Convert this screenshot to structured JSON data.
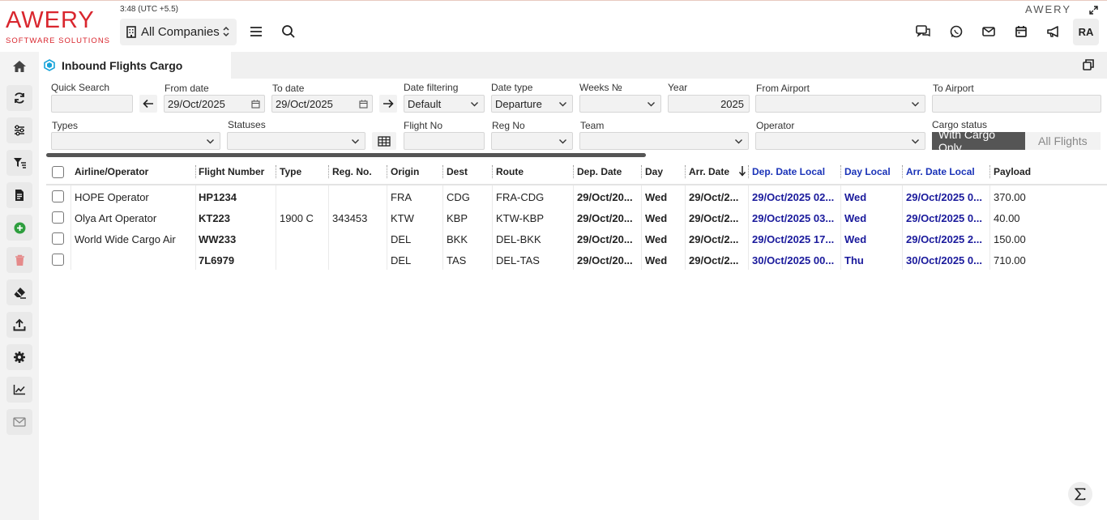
{
  "app": {
    "logo": "AWERY",
    "logo_sub": "SOFTWARE SOLUTIONS",
    "clock": "3:48 (UTC +5.5)",
    "company": "All Companies",
    "brand_small": "AWERY",
    "avatar": "RA"
  },
  "tab": {
    "title": "Inbound Flights Cargo"
  },
  "filters": {
    "quick_search_label": "Quick Search",
    "quick_search_value": "",
    "from_date_label": "From date",
    "from_date_value": "29/Oct/2025",
    "to_date_label": "To date",
    "to_date_value": "29/Oct/2025",
    "date_filtering_label": "Date filtering",
    "date_filtering_value": "Default",
    "date_type_label": "Date type",
    "date_type_value": "Departure",
    "weeks_label": "Weeks №",
    "year_label": "Year",
    "year_value": "2025",
    "from_airport_label": "From Airport",
    "to_airport_label": "To Airport",
    "types_label": "Types",
    "statuses_label": "Statuses",
    "flight_no_label": "Flight No",
    "reg_no_label": "Reg No",
    "team_label": "Team",
    "operator_label": "Operator",
    "cargo_status_label": "Cargo status",
    "cargo_on": "With Cargo Only",
    "cargo_off": "All Flights"
  },
  "table": {
    "columns": [
      "Airline/Operator",
      "Flight Number",
      "Type",
      "Reg. No.",
      "Origin",
      "Dest",
      "Route",
      "Dep. Date",
      "Day",
      "Arr. Date",
      "Dep. Date Local",
      "Day Local",
      "Arr. Date Local",
      "Payload"
    ],
    "rows": [
      {
        "airline": "HOPE Operator",
        "flight": "HP1234",
        "type": "",
        "reg": "",
        "origin": "FRA",
        "dest": "CDG",
        "route": "FRA-CDG",
        "dep": "29/Oct/20...",
        "day": "Wed",
        "arr": "29/Oct/2...",
        "dep_local": "29/Oct/2025 02...",
        "day_local": "Wed",
        "arr_local": "29/Oct/2025 0...",
        "payload": "370.00"
      },
      {
        "airline": "Olya Art Operator",
        "flight": "KT223",
        "type": "1900 C",
        "reg": "343453",
        "origin": "KTW",
        "dest": "KBP",
        "route": "KTW-KBP",
        "dep": "29/Oct/20...",
        "day": "Wed",
        "arr": "29/Oct/2...",
        "dep_local": "29/Oct/2025 03...",
        "day_local": "Wed",
        "arr_local": "29/Oct/2025 0...",
        "payload": "40.00"
      },
      {
        "airline": "World Wide Cargo Air",
        "flight": "WW233",
        "type": "",
        "reg": "",
        "origin": "DEL",
        "dest": "BKK",
        "route": "DEL-BKK",
        "dep": "29/Oct/20...",
        "day": "Wed",
        "arr": "29/Oct/2...",
        "dep_local": "29/Oct/2025 17...",
        "day_local": "Wed",
        "arr_local": "29/Oct/2025 2...",
        "payload": "150.00"
      },
      {
        "airline": "",
        "flight": "7L6979",
        "type": "",
        "reg": "",
        "origin": "DEL",
        "dest": "TAS",
        "route": "DEL-TAS",
        "dep": "29/Oct/20...",
        "day": "Wed",
        "arr": "29/Oct/2...",
        "dep_local": "30/Oct/2025 00...",
        "day_local": "Thu",
        "arr_local": "30/Oct/2025 0...",
        "payload": "710.00"
      }
    ]
  },
  "colors": {
    "brand": "#d9262e",
    "local_blue": "#1a1a9c",
    "add_green": "#2e9e3e",
    "delete_red": "#e06060"
  }
}
